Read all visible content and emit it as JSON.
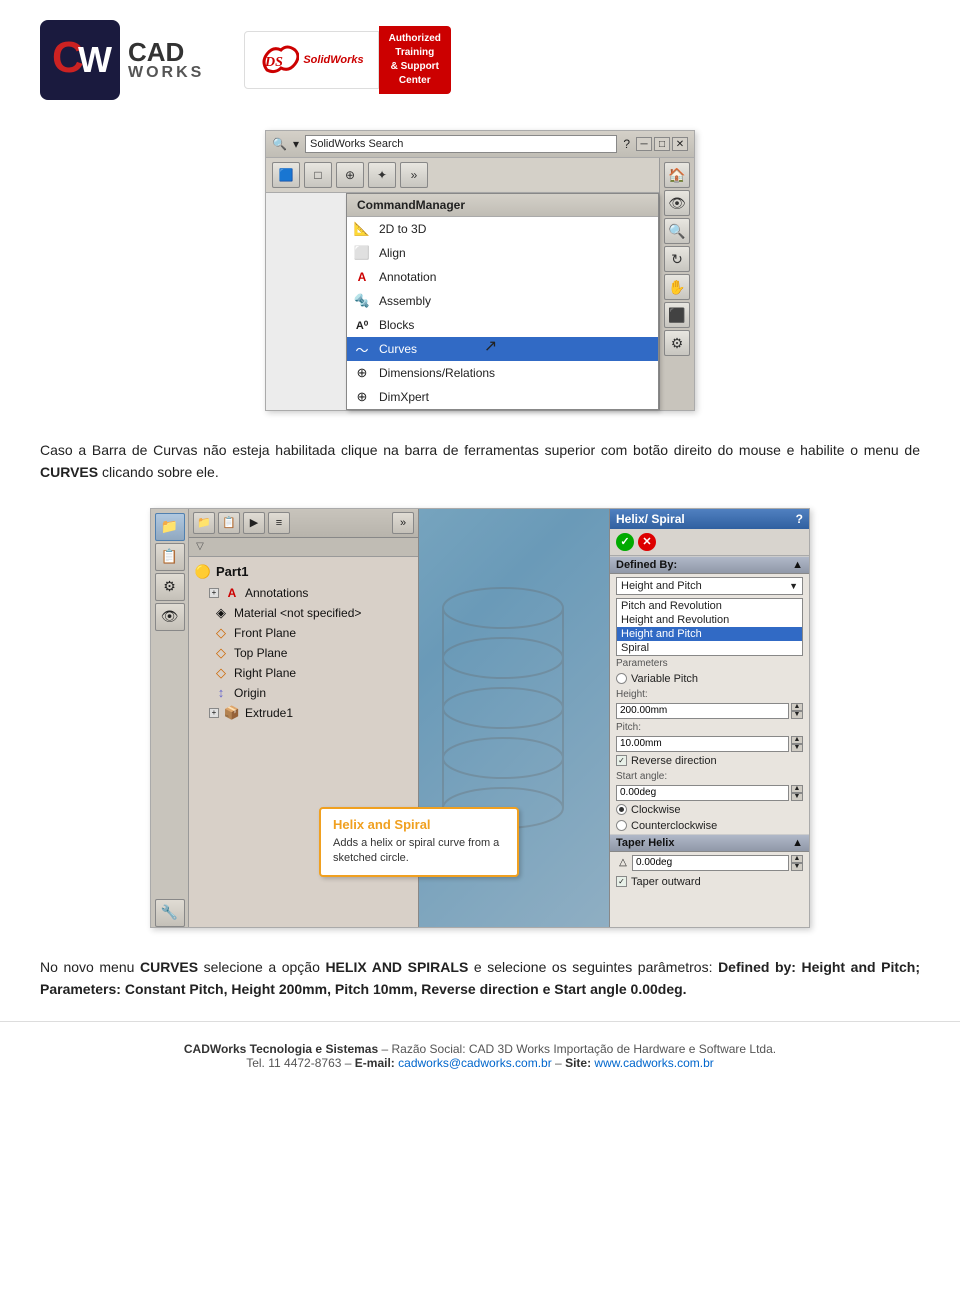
{
  "header": {
    "cw_logo_text": "CAD\nWORKS",
    "sw_badge_lines": [
      "Authorized",
      "Training",
      "& Support",
      "Center"
    ]
  },
  "screenshot1": {
    "titlebar": "SolidWorks Search",
    "menu_title": "CommandManager",
    "menu_items": [
      {
        "label": "2D to 3D",
        "icon": "📐",
        "active": false
      },
      {
        "label": "Align",
        "icon": "⬜",
        "active": false
      },
      {
        "label": "Annotation",
        "icon": "A",
        "active": false
      },
      {
        "label": "Assembly",
        "icon": "🔩",
        "active": false
      },
      {
        "label": "Blocks",
        "icon": "A",
        "active": false
      },
      {
        "label": "Curves",
        "icon": "〜",
        "active": true
      },
      {
        "label": "Dimensions/Relations",
        "icon": "⊕",
        "active": false
      },
      {
        "label": "DimXpert",
        "icon": "⊕",
        "active": false
      }
    ]
  },
  "desc1": {
    "text": "Caso a Barra de Curvas não esteja habilitada clique na barra de ferramentas superior com botão direito do mouse e habilite o menu de ",
    "bold": "CURVES",
    "text2": " clicando sobre ele."
  },
  "feature_tree": {
    "root": "Part1",
    "items": [
      {
        "label": "Annotations",
        "icon": "A",
        "expandable": true
      },
      {
        "label": "Material <not specified>",
        "icon": "◈",
        "expandable": false
      },
      {
        "label": "Front Plane",
        "icon": "◇",
        "expandable": false
      },
      {
        "label": "Top Plane",
        "icon": "◇",
        "expandable": false
      },
      {
        "label": "Right Plane",
        "icon": "◇",
        "expandable": false
      },
      {
        "label": "Origin",
        "icon": "↕",
        "expandable": false
      },
      {
        "label": "Extrude1",
        "icon": "📦",
        "expandable": true
      }
    ]
  },
  "helix_tooltip": {
    "title": "Helix and Spiral",
    "description": "Adds a helix or spiral curve from a sketched circle."
  },
  "helix_panel": {
    "title": "Helix/ Spiral",
    "defined_by_label": "Defined By:",
    "dropdown_selected": "Height and Pitch",
    "dropdown_options": [
      "Pitch and Revolution",
      "Height and Revolution",
      "Height and Pitch",
      "Spiral"
    ],
    "variable_pitch_label": "Variable Pitch",
    "height_label": "Height:",
    "height_value": "200.00mm",
    "pitch_label": "Pitch:",
    "pitch_value": "10.00mm",
    "reverse_direction_label": "Reverse direction",
    "start_angle_label": "Start angle:",
    "start_angle_value": "0.00deg",
    "clockwise_label": "Clockwise",
    "counterclockwise_label": "Counterclockwise",
    "taper_helix_label": "Taper Helix",
    "taper_value": "0.00deg",
    "taper_outward_label": "Taper outward"
  },
  "desc2": {
    "line1": "No novo menu CURVES selecione a opção HELIX AND SPIRALS e selecione os seguintes parâmetros: Defined",
    "line2": "by: Height and Pitch; Parameters: Constant Pitch, Height 200mm, Pitch 10mm, Reverse direction e Start",
    "line3": "angle 0.00deg."
  },
  "footer": {
    "company": "CADWorks Tecnologia e Sistemas",
    "razao": "Razão Social: CAD 3D Works Importação de Hardware e Software Ltda.",
    "tel_label": "Tel.",
    "tel": "11 4472-8763",
    "email_label": "E-mail:",
    "email": "cadworks@cadworks.com.br",
    "site_label": "Site:",
    "site": "www.cadworks.com.br"
  }
}
